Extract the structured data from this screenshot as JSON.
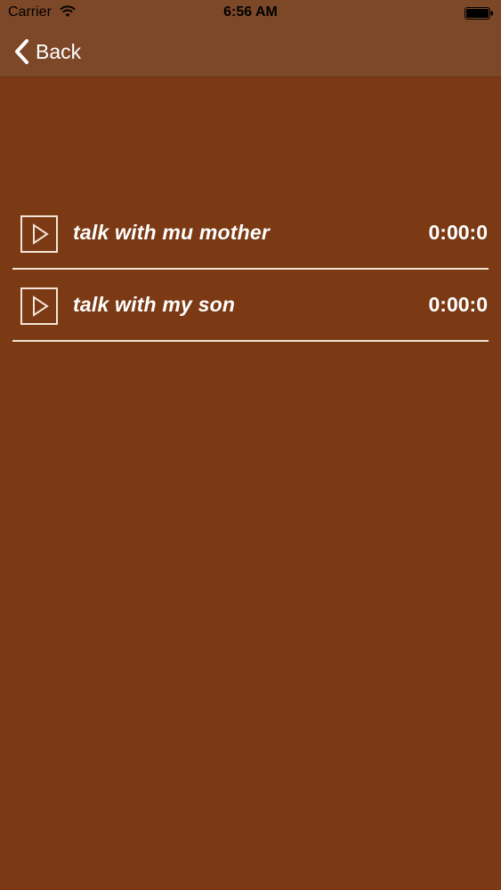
{
  "status_bar": {
    "carrier": "Carrier",
    "time": "6:56 AM"
  },
  "nav": {
    "back_label": "Back"
  },
  "recordings": [
    {
      "title": "talk with mu mother",
      "duration": "0:00:0"
    },
    {
      "title": "talk with my son",
      "duration": "0:00:0"
    }
  ],
  "colors": {
    "background": "#7b3914",
    "header": "#7d4828",
    "divider": "#f2e3d6",
    "text": "#ffffff"
  },
  "icons": {
    "back": "chevron-left-icon",
    "play": "play-icon",
    "wifi": "wifi-icon",
    "battery": "battery-icon"
  }
}
